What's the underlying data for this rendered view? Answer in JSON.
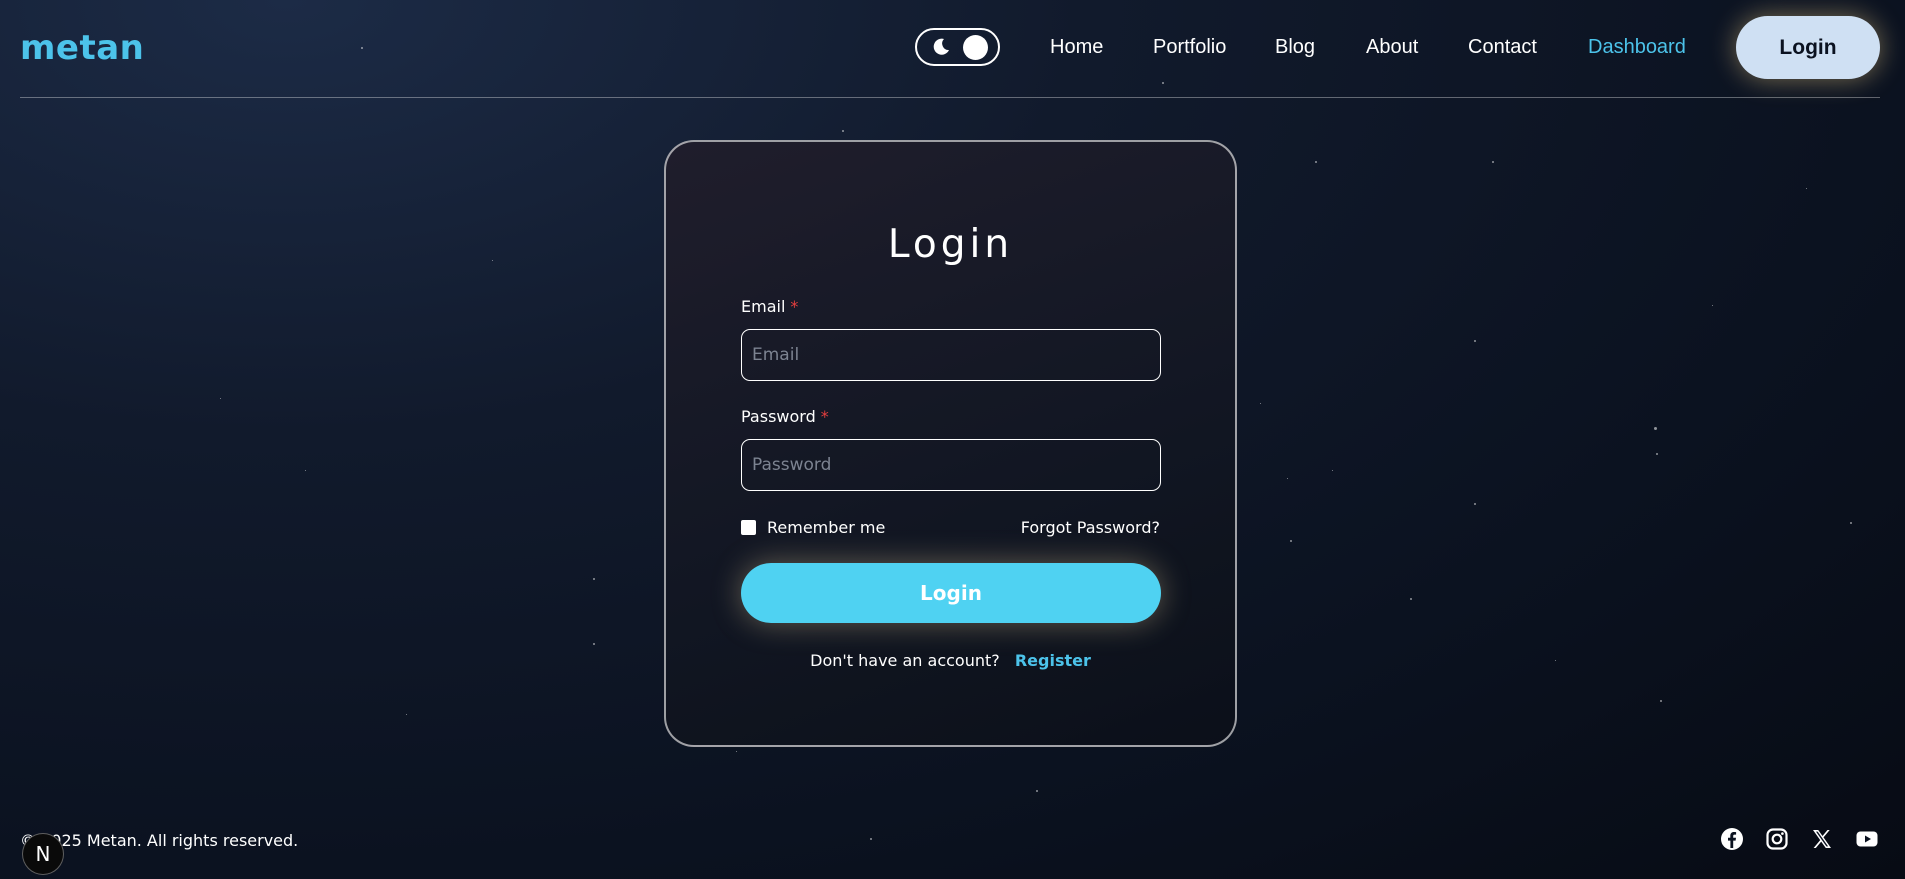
{
  "brand": {
    "name": "metan",
    "accent": "#4cc3ea"
  },
  "header": {
    "theme_toggle_icon": "moon-icon",
    "nav": [
      {
        "label": "Home"
      },
      {
        "label": "Portfolio"
      },
      {
        "label": "Blog"
      },
      {
        "label": "About"
      },
      {
        "label": "Contact"
      },
      {
        "label": "Dashboard",
        "active": true
      }
    ],
    "login_label": "Login"
  },
  "login_form": {
    "title": "Login",
    "email": {
      "label": "Email",
      "required_mark": "*",
      "placeholder": "Email",
      "value": ""
    },
    "password": {
      "label": "Password",
      "required_mark": "*",
      "placeholder": "Password",
      "value": ""
    },
    "remember_label": "Remember me",
    "remember_checked": false,
    "forgot_label": "Forgot Password?",
    "submit_label": "Login",
    "register_prompt": "Don't have an account?",
    "register_label": "Register",
    "button_color": "#4fd2f2"
  },
  "footer": {
    "copyright": "© 2025 Metan. All rights reserved.",
    "next_badge": "N",
    "social": [
      "facebook-icon",
      "instagram-icon",
      "x-icon",
      "youtube-icon"
    ]
  }
}
